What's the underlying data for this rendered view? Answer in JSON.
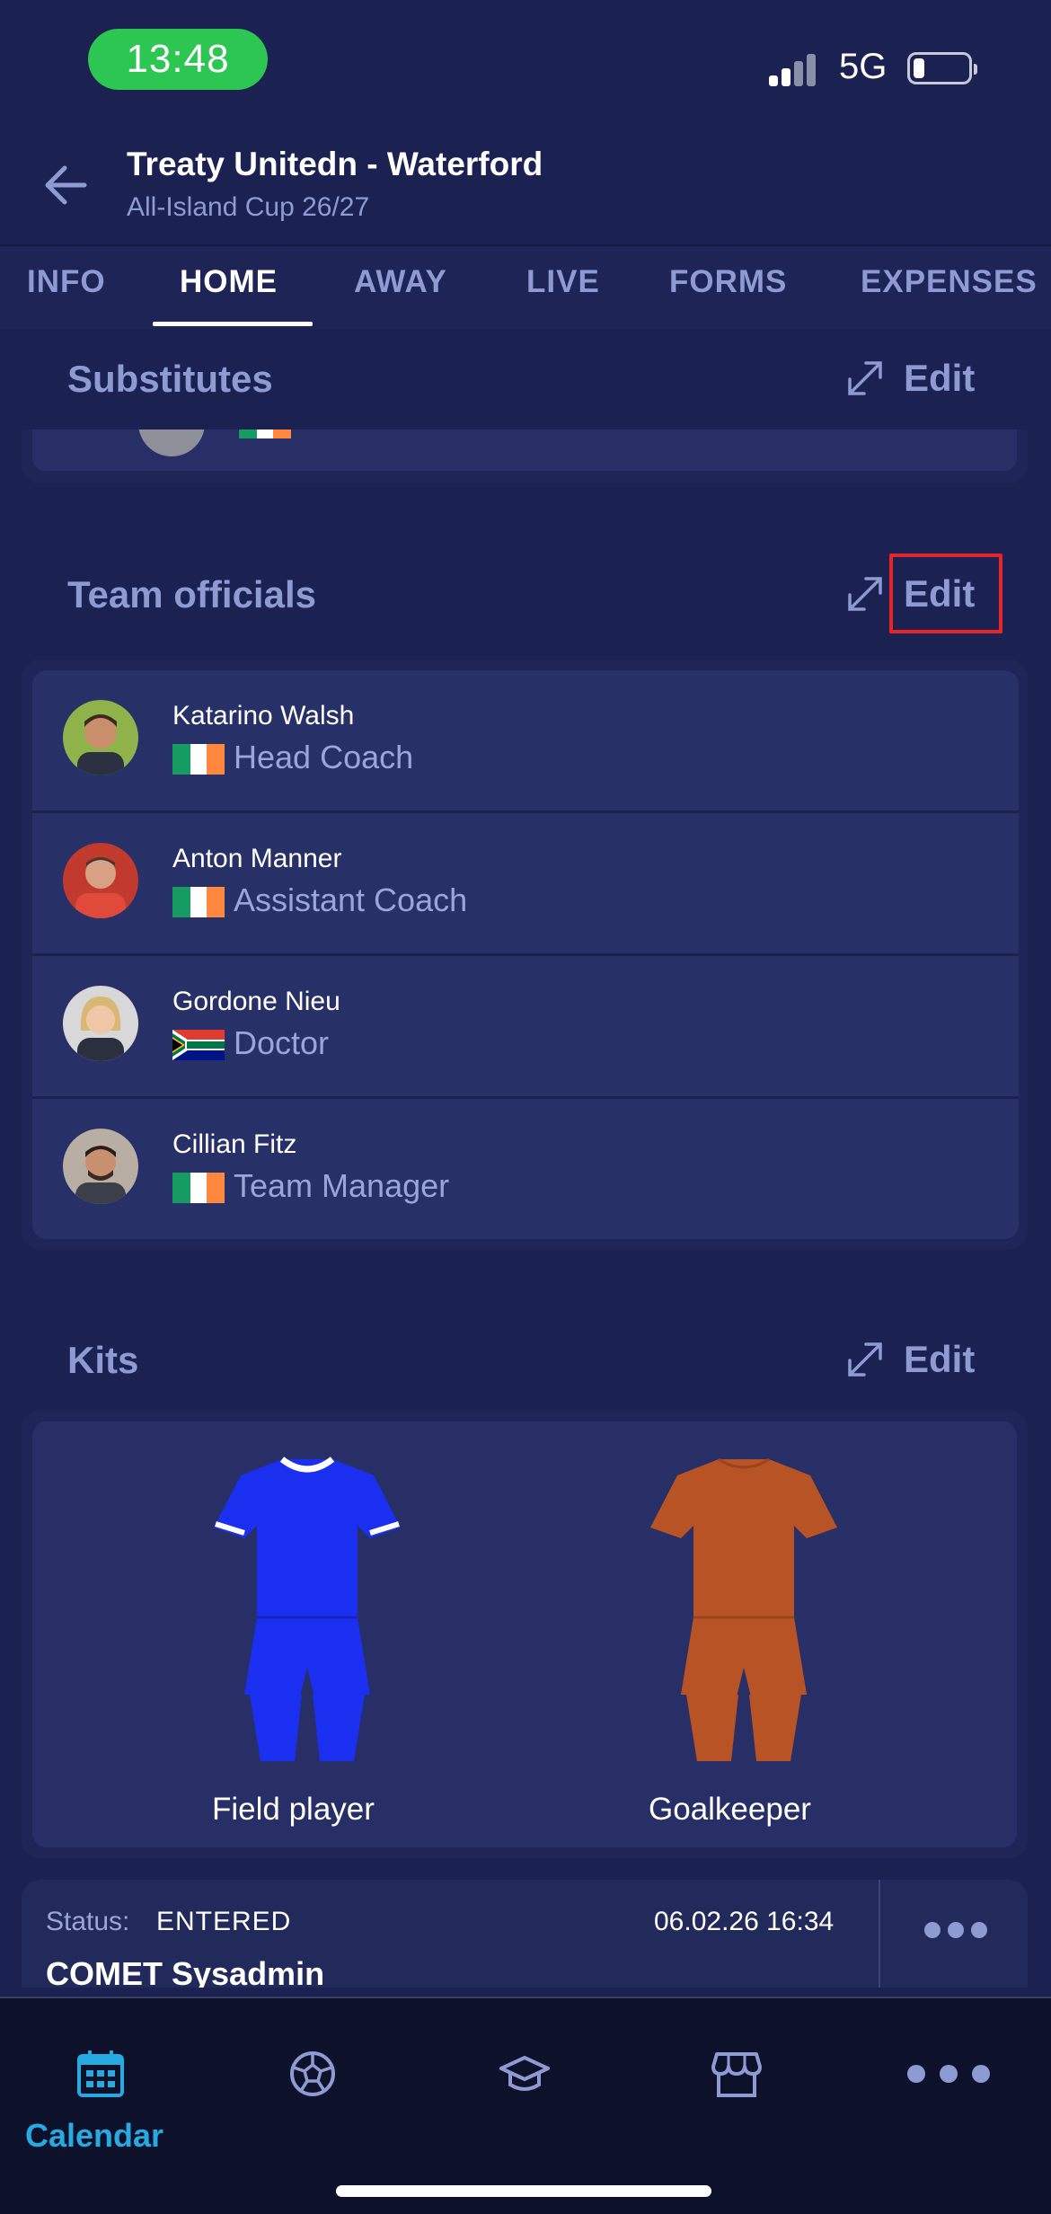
{
  "status_bar": {
    "time": "13:48",
    "network": "5G"
  },
  "header": {
    "title": "Treaty Unitedn - Waterford",
    "subtitle": "All-Island Cup 26/27"
  },
  "tabs": [
    {
      "label": "INFO"
    },
    {
      "label": "HOME"
    },
    {
      "label": "AWAY"
    },
    {
      "label": "LIVE"
    },
    {
      "label": "FORMS"
    },
    {
      "label": "EXPENSES"
    }
  ],
  "active_tab": "HOME",
  "sections": {
    "substitutes": {
      "title": "Substitutes",
      "edit_label": "Edit"
    },
    "team_officials": {
      "title": "Team officials",
      "edit_label": "Edit",
      "officials": [
        {
          "name": "Katarino Walsh",
          "role": "Head Coach",
          "flag": "ireland-flag"
        },
        {
          "name": "Anton Manner",
          "role": "Assistant Coach",
          "flag": "ireland-flag"
        },
        {
          "name": "Gordone Nieu",
          "role": "Doctor",
          "flag": "south-africa-flag"
        },
        {
          "name": "Cillian Fitz",
          "role": "Team Manager",
          "flag": "ireland-flag"
        }
      ]
    },
    "kits": {
      "title": "Kits",
      "edit_label": "Edit",
      "items": [
        {
          "label": "Field player",
          "color": "#1a2ff0"
        },
        {
          "label": "Goalkeeper",
          "color": "#b75325"
        }
      ]
    }
  },
  "status_card": {
    "status_label": "Status:",
    "status_value": "ENTERED",
    "date": "06.02.26 16:34",
    "user": "COMET Sysadmin"
  },
  "bottom_nav": {
    "items": [
      {
        "icon": "calendar-icon",
        "label": "Calendar",
        "active": true
      },
      {
        "icon": "football-icon"
      },
      {
        "icon": "graduation-cap-icon"
      },
      {
        "icon": "store-icon"
      },
      {
        "icon": "more-icon"
      }
    ],
    "accent_color": "#27a9e1"
  },
  "colors": {
    "background": "#1b2150",
    "muted_text": "#8e9bd3",
    "highlight": "#e5252a"
  }
}
